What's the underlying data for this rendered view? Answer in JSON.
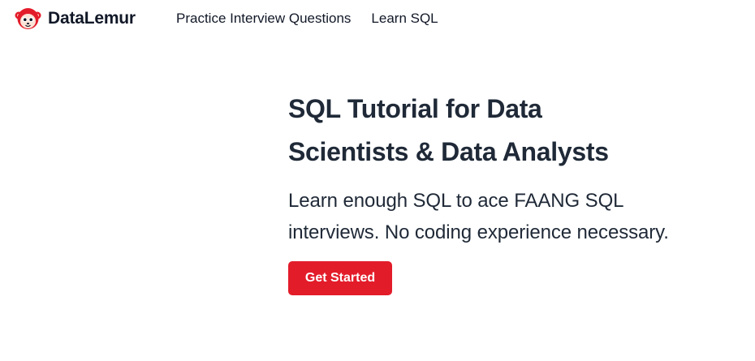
{
  "navbar": {
    "brand_name": "DataLemur",
    "logo_icon": "lemur-logo-icon",
    "links": [
      {
        "label": "Practice Interview Questions"
      },
      {
        "label": "Learn SQL"
      }
    ]
  },
  "hero": {
    "title_line1": "SQL Tutorial for Data",
    "title_line2": "Scientists & Data Analysts",
    "subtitle_line1": "Learn enough SQL to ace FAANG SQL",
    "subtitle_line2": "interviews. No coding experience necessary.",
    "cta_label": "Get Started"
  },
  "colors": {
    "brand_red": "#e31c2a",
    "text_dark": "#1f2937",
    "background": "#ffffff"
  }
}
